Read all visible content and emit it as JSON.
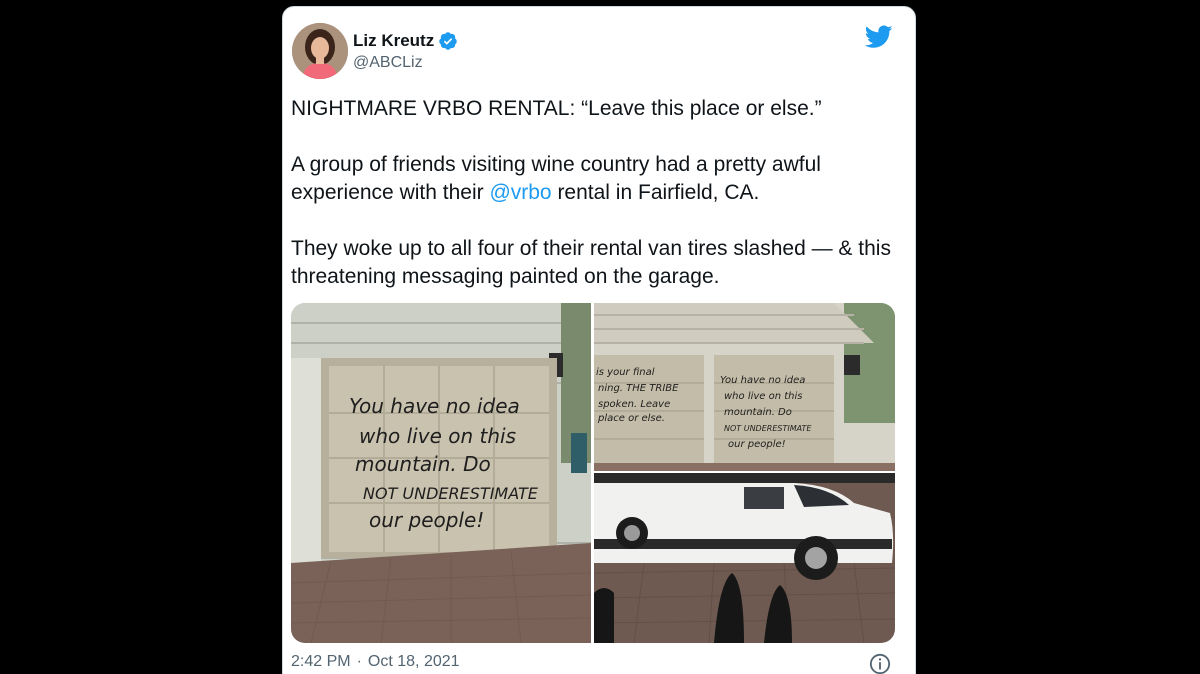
{
  "author": {
    "name": "Liz Kreutz",
    "handle": "@ABCLiz",
    "verified_icon": "verified-badge-icon",
    "avatar_icon": "profile-photo"
  },
  "tweet": {
    "line1": "NIGHTMARE VRBO RENTAL: “Leave this place or else.”",
    "para2_before": "A group of friends visiting wine country had a pretty awful experience with their ",
    "para2_mention": "@vrbo",
    "para2_after": " rental in Fairfield, CA.",
    "para3": "They woke up to all four of their rental van tires slashed — & this threatening messaging painted on the garage."
  },
  "media": {
    "image1_graffiti": [
      "You have no idea",
      "who live on this",
      "mountain. Do",
      "NOT UNDERESTIMATE",
      "our people!"
    ],
    "image2_graffiti_left": [
      "is your final",
      "ning. THE TRIBE",
      "spoken. Leave",
      "place or else."
    ],
    "image2_graffiti_right": [
      "You have no idea",
      "who live on this",
      "mountain. Do",
      "NOT UNDERESTIMATE",
      "our people!"
    ]
  },
  "footer": {
    "time": "2:42 PM",
    "separator": "·",
    "date": "Oct 18, 2021"
  },
  "colors": {
    "accent": "#1d9bf0",
    "text": "#0f1419",
    "muted": "#536471"
  }
}
